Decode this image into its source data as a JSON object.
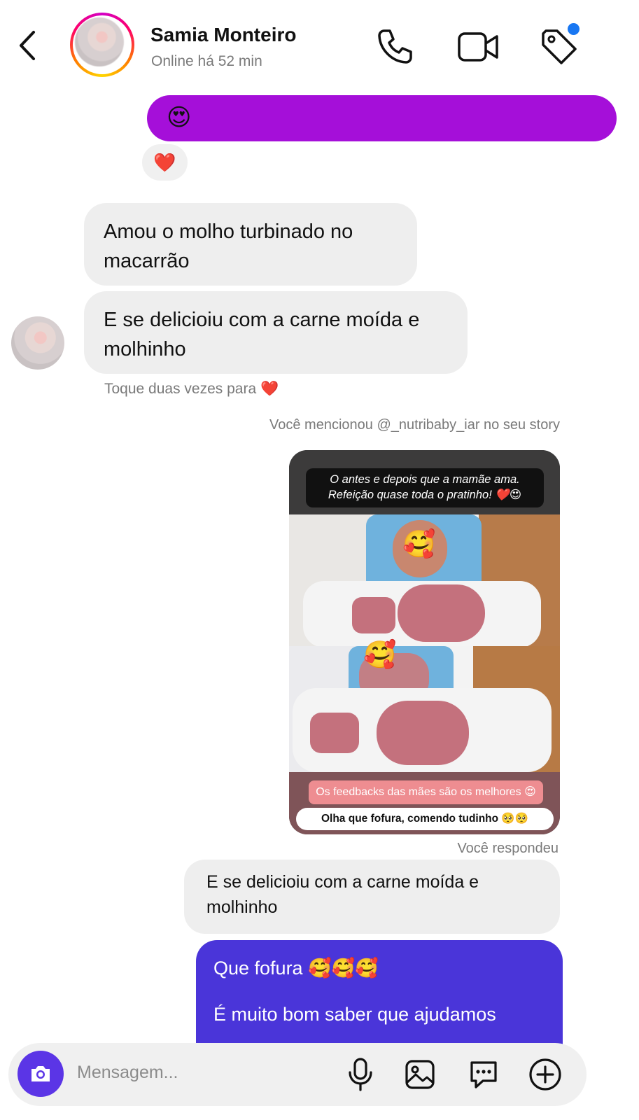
{
  "header": {
    "contact_name": "Samia Monteiro",
    "status": "Online há 52 min",
    "icons": [
      "back-arrow-icon",
      "phone-icon",
      "video-camera-icon",
      "tag-icon"
    ],
    "accent_dot_color": "#1877f2"
  },
  "messages": {
    "sent_emoji": "😍",
    "reaction": "❤️",
    "received_1": "Amou o molho turbinado no macarrão",
    "received_2": "E se delicioiu com a carne moída e molhinho",
    "double_tap_hint": "Toque duas vezes para ❤️",
    "mention_meta": "Você mencionou @_nutribaby_iar no seu story",
    "story": {
      "caption": "O antes e depois que a mamãe ama.\nRefeição quase toda o pratinho! ❤️😍",
      "pill_pink": "Os feedbacks das mães são os melhores 😍",
      "pill_white": "Olha que fofura, comendo tudinho 🥺🥺",
      "face_emoji": "🥰"
    },
    "replied_meta": "Você respondeu",
    "reply_quote": "E se delicioiu com a carne moída e molhinho",
    "sent_line_1": "Que fofura 🥰🥰🥰",
    "sent_line_2": "É muito bom saber que ajudamos"
  },
  "composer": {
    "placeholder": "Mensagem...",
    "icons": [
      "camera-icon",
      "microphone-icon",
      "gallery-icon",
      "sticker-icon",
      "plus-icon"
    ]
  },
  "colors": {
    "sent_purple": "#a50fd9",
    "sent_blue": "#4a35d9",
    "received_gray": "#eeeeee",
    "camera_button": "#5b35e6"
  }
}
